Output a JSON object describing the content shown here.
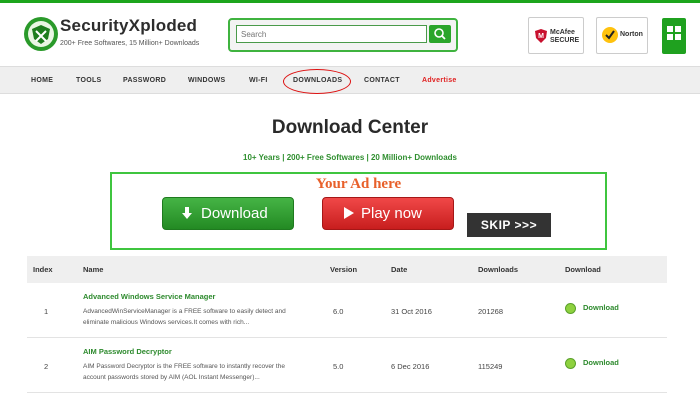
{
  "header": {
    "brand": "SecurityXploded",
    "tagline": "200+ Free Softwares, 15 Million+ Downloads",
    "search_placeholder": "Search",
    "badges": {
      "mcafee": "McAfee SECURE",
      "norton": "Norton",
      "windows_icon": "windows-logo-icon"
    }
  },
  "nav": {
    "items": [
      "HOME",
      "TOOLS",
      "PASSWORD",
      "WINDOWS",
      "WI-FI",
      "DOWNLOADS",
      "CONTACT",
      "Advertise"
    ]
  },
  "page": {
    "title": "Download Center",
    "subtitle": "10+ Years  |  200+ Free Softwares  |  20 Million+ Downloads"
  },
  "ad": {
    "text": "Your Ad here",
    "download_label": "Download",
    "play_label": "Play now",
    "skip_label": "SKIP >>>"
  },
  "table": {
    "headers": [
      "Index",
      "Name",
      "Version",
      "Date",
      "Downloads",
      "Download"
    ],
    "rows": [
      {
        "index": "1",
        "name": "Advanced Windows Service Manager",
        "desc1": "AdvancedWinServiceManager is a FREE software to easily detect and",
        "desc2": "eliminate malicious Windows services.It comes with rich...",
        "version": "6.0",
        "date": "31 Oct 2016",
        "downloads": "201268",
        "link": "Download"
      },
      {
        "index": "2",
        "name": "AIM Password Decryptor",
        "desc1": "AIM Password Decryptor is the FREE software to instantly recover the",
        "desc2": "account passwords stored by AIM (AOL Instant Messenger)...",
        "version": "5.0",
        "date": "6 Dec 2016",
        "downloads": "115249",
        "link": "Download"
      }
    ]
  },
  "colors": {
    "brand_green": "#1da51d",
    "link_green": "#2d8a2d",
    "advertise_red": "#e02020",
    "ad_orange": "#e8602a"
  }
}
